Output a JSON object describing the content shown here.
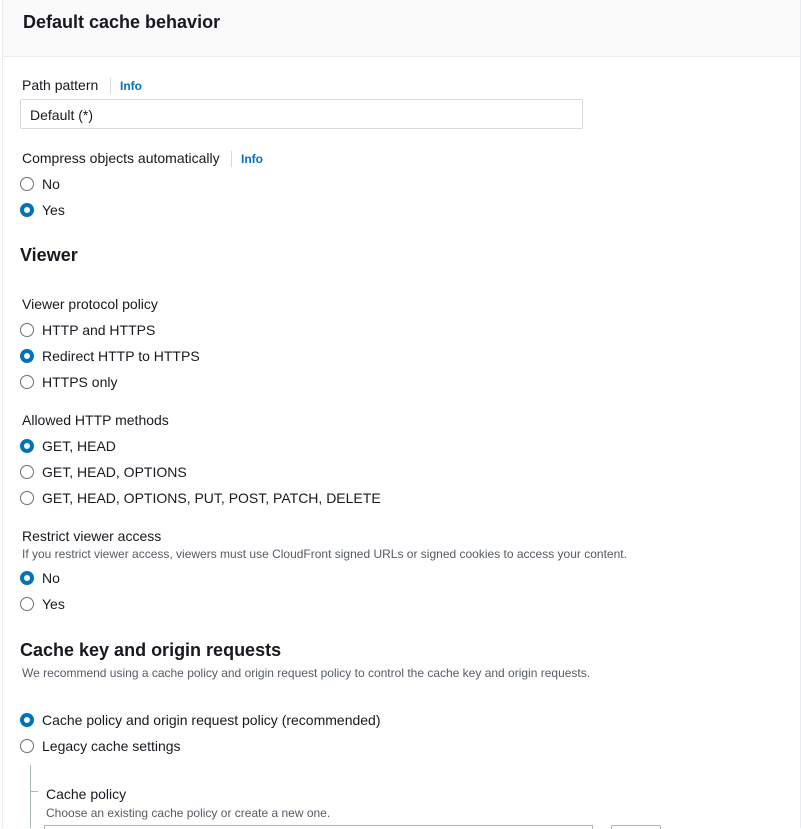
{
  "header": {
    "title": "Default cache behavior"
  },
  "path_pattern": {
    "label": "Path pattern",
    "info": "Info",
    "value": "Default (*)"
  },
  "compress": {
    "label": "Compress objects automatically",
    "info": "Info",
    "options": [
      "No",
      "Yes"
    ],
    "selected": "Yes"
  },
  "viewer": {
    "title": "Viewer",
    "protocol": {
      "label": "Viewer protocol policy",
      "options": [
        "HTTP and HTTPS",
        "Redirect HTTP to HTTPS",
        "HTTPS only"
      ],
      "selected": "Redirect HTTP to HTTPS"
    },
    "methods": {
      "label": "Allowed HTTP methods",
      "options": [
        "GET, HEAD",
        "GET, HEAD, OPTIONS",
        "GET, HEAD, OPTIONS, PUT, POST, PATCH, DELETE"
      ],
      "selected": "GET, HEAD"
    },
    "restrict": {
      "label": "Restrict viewer access",
      "description": "If you restrict viewer access, viewers must use CloudFront signed URLs or signed cookies to access your content.",
      "options": [
        "No",
        "Yes"
      ],
      "selected": "No"
    }
  },
  "cache_key": {
    "title": "Cache key and origin requests",
    "description": "We recommend using a cache policy and origin request policy to control the cache key and origin requests.",
    "options": [
      "Cache policy and origin request policy (recommended)",
      "Legacy cache settings"
    ],
    "selected": "Cache policy and origin request policy (recommended)",
    "cache_policy": {
      "label": "Cache policy",
      "description": "Choose an existing cache policy or create a new one."
    }
  },
  "colors": {
    "accent": "#0073bb",
    "text": "#16191f",
    "muted": "#545b64",
    "border": "#d5dbdb"
  }
}
